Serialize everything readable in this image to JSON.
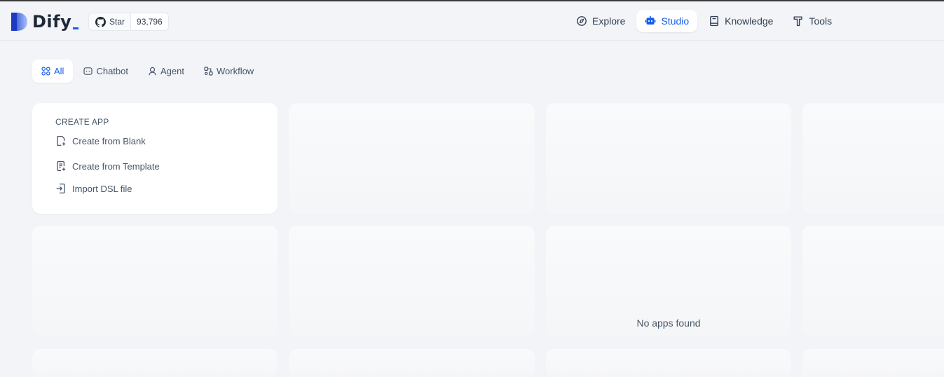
{
  "app": {
    "name": "Dify"
  },
  "github": {
    "star_label": "Star",
    "star_count": "93,796"
  },
  "nav": [
    {
      "label": "Explore",
      "icon": "compass-icon"
    },
    {
      "label": "Studio",
      "icon": "robot-icon",
      "active": true
    },
    {
      "label": "Knowledge",
      "icon": "book-icon"
    },
    {
      "label": "Tools",
      "icon": "hammer-icon"
    }
  ],
  "tabs": [
    {
      "label": "All",
      "icon": "grid-icon",
      "active": true
    },
    {
      "label": "Chatbot",
      "icon": "chat-bubble-icon"
    },
    {
      "label": "Agent",
      "icon": "agent-icon"
    },
    {
      "label": "Workflow",
      "icon": "workflow-icon"
    }
  ],
  "create_app": {
    "title": "CREATE APP",
    "items": [
      {
        "label": "Create from Blank",
        "icon": "file-plus-icon"
      },
      {
        "label": "Create from Template",
        "icon": "template-icon"
      },
      {
        "label": "Import DSL file",
        "icon": "file-import-icon"
      }
    ]
  },
  "empty_state": {
    "message": "No apps found"
  },
  "colors": {
    "accent": "#155eef",
    "background": "#f2f4f7",
    "card": "#ffffff"
  }
}
